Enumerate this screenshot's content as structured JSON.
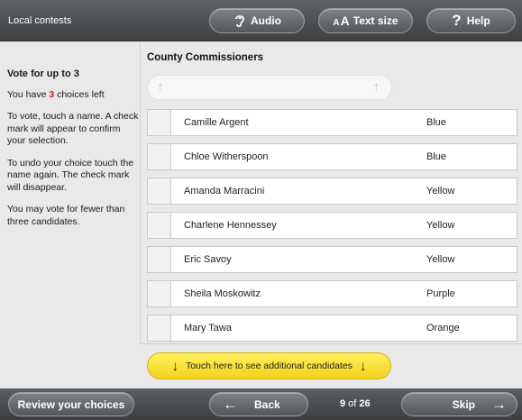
{
  "topbar": {
    "contest_label": "Local contests",
    "audio_label": "Audio",
    "textsize_label": "Text size",
    "help_label": "Help",
    "icons": [
      "ear-icon",
      "text-size-icon",
      "question-icon"
    ]
  },
  "instructions": {
    "heading": "Vote for up to 3",
    "choices_prefix": "You have ",
    "choices_left": "3",
    "choices_suffix": " choices left",
    "how_to_vote": "To vote, touch a name. A check mark will appear to confirm your selection.",
    "how_to_undo": "To undo your choice touch the name again. The check mark will disappear.",
    "vote_fewer": "You may vote for fewer than three candidates."
  },
  "contest": {
    "title": "County Commissioners",
    "candidates": [
      {
        "name": "Camille Argent",
        "party": "Blue"
      },
      {
        "name": "Chloe Witherspoon",
        "party": "Blue"
      },
      {
        "name": "Amanda Marracini",
        "party": "Yellow"
      },
      {
        "name": "Charlene Hennessey",
        "party": "Yellow"
      },
      {
        "name": "Eric Savoy",
        "party": "Yellow"
      },
      {
        "name": "Sheila Moskowitz",
        "party": "Purple"
      },
      {
        "name": "Mary Tawa",
        "party": "Orange"
      }
    ],
    "more_label": "Touch here to see additional candidates"
  },
  "bottombar": {
    "review_label": "Review your choices",
    "back_label": "Back",
    "skip_label": "Skip",
    "page_current": "9",
    "page_of": " of ",
    "page_total": "26"
  },
  "colors": {
    "accent_yellow": "#f3d21d",
    "choices_red": "#d21e1e",
    "bar_dark": "#3e4042"
  }
}
